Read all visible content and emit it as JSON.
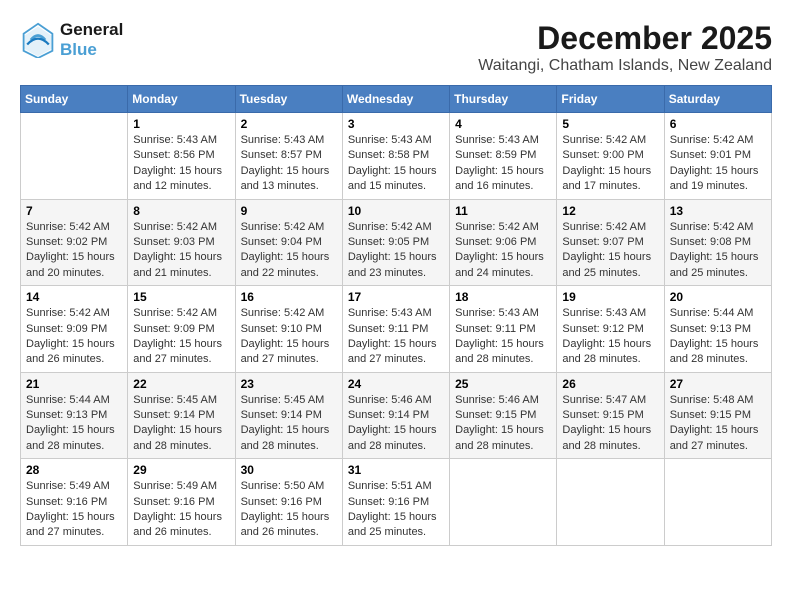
{
  "logo": {
    "line1": "General",
    "line2": "Blue"
  },
  "title": "December 2025",
  "location": "Waitangi, Chatham Islands, New Zealand",
  "days_header": [
    "Sunday",
    "Monday",
    "Tuesday",
    "Wednesday",
    "Thursday",
    "Friday",
    "Saturday"
  ],
  "weeks": [
    [
      {
        "num": "",
        "info": ""
      },
      {
        "num": "1",
        "info": "Sunrise: 5:43 AM\nSunset: 8:56 PM\nDaylight: 15 hours\nand 12 minutes."
      },
      {
        "num": "2",
        "info": "Sunrise: 5:43 AM\nSunset: 8:57 PM\nDaylight: 15 hours\nand 13 minutes."
      },
      {
        "num": "3",
        "info": "Sunrise: 5:43 AM\nSunset: 8:58 PM\nDaylight: 15 hours\nand 15 minutes."
      },
      {
        "num": "4",
        "info": "Sunrise: 5:43 AM\nSunset: 8:59 PM\nDaylight: 15 hours\nand 16 minutes."
      },
      {
        "num": "5",
        "info": "Sunrise: 5:42 AM\nSunset: 9:00 PM\nDaylight: 15 hours\nand 17 minutes."
      },
      {
        "num": "6",
        "info": "Sunrise: 5:42 AM\nSunset: 9:01 PM\nDaylight: 15 hours\nand 19 minutes."
      }
    ],
    [
      {
        "num": "7",
        "info": "Sunrise: 5:42 AM\nSunset: 9:02 PM\nDaylight: 15 hours\nand 20 minutes."
      },
      {
        "num": "8",
        "info": "Sunrise: 5:42 AM\nSunset: 9:03 PM\nDaylight: 15 hours\nand 21 minutes."
      },
      {
        "num": "9",
        "info": "Sunrise: 5:42 AM\nSunset: 9:04 PM\nDaylight: 15 hours\nand 22 minutes."
      },
      {
        "num": "10",
        "info": "Sunrise: 5:42 AM\nSunset: 9:05 PM\nDaylight: 15 hours\nand 23 minutes."
      },
      {
        "num": "11",
        "info": "Sunrise: 5:42 AM\nSunset: 9:06 PM\nDaylight: 15 hours\nand 24 minutes."
      },
      {
        "num": "12",
        "info": "Sunrise: 5:42 AM\nSunset: 9:07 PM\nDaylight: 15 hours\nand 25 minutes."
      },
      {
        "num": "13",
        "info": "Sunrise: 5:42 AM\nSunset: 9:08 PM\nDaylight: 15 hours\nand 25 minutes."
      }
    ],
    [
      {
        "num": "14",
        "info": "Sunrise: 5:42 AM\nSunset: 9:09 PM\nDaylight: 15 hours\nand 26 minutes."
      },
      {
        "num": "15",
        "info": "Sunrise: 5:42 AM\nSunset: 9:09 PM\nDaylight: 15 hours\nand 27 minutes."
      },
      {
        "num": "16",
        "info": "Sunrise: 5:42 AM\nSunset: 9:10 PM\nDaylight: 15 hours\nand 27 minutes."
      },
      {
        "num": "17",
        "info": "Sunrise: 5:43 AM\nSunset: 9:11 PM\nDaylight: 15 hours\nand 27 minutes."
      },
      {
        "num": "18",
        "info": "Sunrise: 5:43 AM\nSunset: 9:11 PM\nDaylight: 15 hours\nand 28 minutes."
      },
      {
        "num": "19",
        "info": "Sunrise: 5:43 AM\nSunset: 9:12 PM\nDaylight: 15 hours\nand 28 minutes."
      },
      {
        "num": "20",
        "info": "Sunrise: 5:44 AM\nSunset: 9:13 PM\nDaylight: 15 hours\nand 28 minutes."
      }
    ],
    [
      {
        "num": "21",
        "info": "Sunrise: 5:44 AM\nSunset: 9:13 PM\nDaylight: 15 hours\nand 28 minutes."
      },
      {
        "num": "22",
        "info": "Sunrise: 5:45 AM\nSunset: 9:14 PM\nDaylight: 15 hours\nand 28 minutes."
      },
      {
        "num": "23",
        "info": "Sunrise: 5:45 AM\nSunset: 9:14 PM\nDaylight: 15 hours\nand 28 minutes."
      },
      {
        "num": "24",
        "info": "Sunrise: 5:46 AM\nSunset: 9:14 PM\nDaylight: 15 hours\nand 28 minutes."
      },
      {
        "num": "25",
        "info": "Sunrise: 5:46 AM\nSunset: 9:15 PM\nDaylight: 15 hours\nand 28 minutes."
      },
      {
        "num": "26",
        "info": "Sunrise: 5:47 AM\nSunset: 9:15 PM\nDaylight: 15 hours\nand 28 minutes."
      },
      {
        "num": "27",
        "info": "Sunrise: 5:48 AM\nSunset: 9:15 PM\nDaylight: 15 hours\nand 27 minutes."
      }
    ],
    [
      {
        "num": "28",
        "info": "Sunrise: 5:49 AM\nSunset: 9:16 PM\nDaylight: 15 hours\nand 27 minutes."
      },
      {
        "num": "29",
        "info": "Sunrise: 5:49 AM\nSunset: 9:16 PM\nDaylight: 15 hours\nand 26 minutes."
      },
      {
        "num": "30",
        "info": "Sunrise: 5:50 AM\nSunset: 9:16 PM\nDaylight: 15 hours\nand 26 minutes."
      },
      {
        "num": "31",
        "info": "Sunrise: 5:51 AM\nSunset: 9:16 PM\nDaylight: 15 hours\nand 25 minutes."
      },
      {
        "num": "",
        "info": ""
      },
      {
        "num": "",
        "info": ""
      },
      {
        "num": "",
        "info": ""
      }
    ]
  ]
}
